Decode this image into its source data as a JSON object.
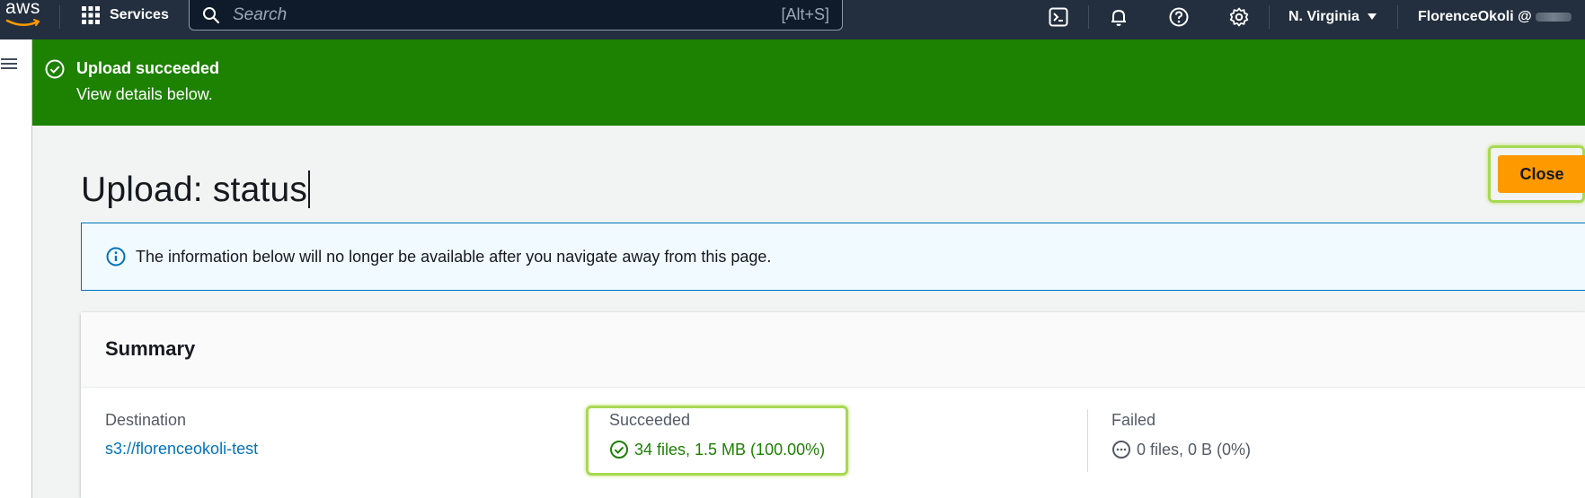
{
  "topnav": {
    "logo_text": "aws",
    "services_label": "Services",
    "search": {
      "placeholder": "Search",
      "shortcut": "[Alt+S]"
    },
    "region_label": "N. Virginia",
    "account_label": "FlorenceOkoli @",
    "icons": [
      "cloudshell-icon",
      "bell-icon",
      "help-icon",
      "settings-icon"
    ]
  },
  "flash": {
    "title": "Upload succeeded",
    "message": "View details below.",
    "color": "#1d8102"
  },
  "page": {
    "title": "Upload: status",
    "close_label": "Close",
    "accent": "#ff9900"
  },
  "info": {
    "text": "The information below will no longer be available after you navigate away from this page."
  },
  "summary": {
    "heading": "Summary",
    "destination": {
      "label": "Destination",
      "value": "s3://florenceokoli-test"
    },
    "succeeded": {
      "label": "Succeeded",
      "value": "34 files, 1.5 MB (100.00%)"
    },
    "failed": {
      "label": "Failed",
      "value": "0 files, 0 B (0%)"
    }
  },
  "colors": {
    "success": "#1d8102",
    "link": "#0073bb",
    "highlight": "#a8d952"
  }
}
